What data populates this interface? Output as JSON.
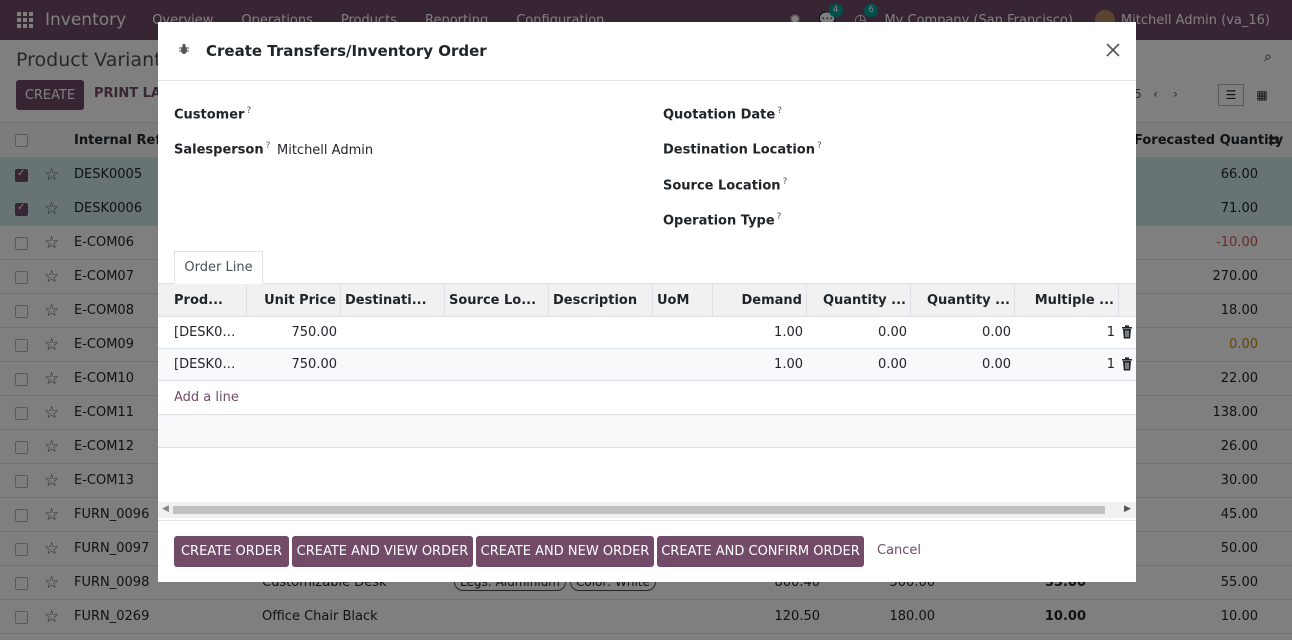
{
  "colors": {
    "brand": "#714b67",
    "selected_row": "#d0e6e6",
    "negative": "#d9534f",
    "warning": "#d08a0a"
  },
  "navbar": {
    "app_name": "Inventory",
    "menus": [
      "Overview",
      "Operations",
      "Products",
      "Reporting",
      "Configuration"
    ],
    "messages_count": "4",
    "activities_count": "6",
    "company": "My Company (San Francisco)",
    "user": "Mitchell Admin (va_16)"
  },
  "page": {
    "title": "Product Variants",
    "create_label": "CREATE",
    "print_label": "PRINT LAB",
    "pager": "5"
  },
  "list": {
    "headers": {
      "ref": "Internal Refer",
      "forecast": "Forecasted Quantity"
    },
    "rows": [
      {
        "ref": "DESK0005",
        "name": "",
        "attrs": [],
        "n1": "",
        "n2": "",
        "n3": "",
        "fq": "66.00",
        "selected": true,
        "tone": ""
      },
      {
        "ref": "DESK0006",
        "name": "",
        "attrs": [],
        "n1": "",
        "n2": "",
        "n3": "",
        "fq": "71.00",
        "selected": true,
        "tone": ""
      },
      {
        "ref": "E-COM06",
        "name": "",
        "attrs": [],
        "n1": "",
        "n2": "",
        "n3": "",
        "fq": "-10.00",
        "selected": false,
        "tone": "red"
      },
      {
        "ref": "E-COM07",
        "name": "",
        "attrs": [],
        "n1": "",
        "n2": "",
        "n3": "",
        "fq": "270.00",
        "selected": false,
        "tone": ""
      },
      {
        "ref": "E-COM08",
        "name": "",
        "attrs": [],
        "n1": "",
        "n2": "",
        "n3": "",
        "fq": "18.00",
        "selected": false,
        "tone": ""
      },
      {
        "ref": "E-COM09",
        "name": "",
        "attrs": [],
        "n1": "",
        "n2": "",
        "n3": "",
        "fq": "0.00",
        "selected": false,
        "tone": "orange"
      },
      {
        "ref": "E-COM10",
        "name": "",
        "attrs": [],
        "n1": "",
        "n2": "",
        "n3": "",
        "fq": "22.00",
        "selected": false,
        "tone": ""
      },
      {
        "ref": "E-COM11",
        "name": "",
        "attrs": [],
        "n1": "",
        "n2": "",
        "n3": "",
        "fq": "138.00",
        "selected": false,
        "tone": ""
      },
      {
        "ref": "E-COM12",
        "name": "",
        "attrs": [],
        "n1": "",
        "n2": "",
        "n3": "",
        "fq": "26.00",
        "selected": false,
        "tone": ""
      },
      {
        "ref": "E-COM13",
        "name": "",
        "attrs": [],
        "n1": "",
        "n2": "",
        "n3": "",
        "fq": "30.00",
        "selected": false,
        "tone": ""
      },
      {
        "ref": "FURN_0096",
        "name": "",
        "attrs": [],
        "n1": "",
        "n2": "",
        "n3": "",
        "fq": "45.00",
        "selected": false,
        "tone": ""
      },
      {
        "ref": "FURN_0097",
        "name": "",
        "attrs": [],
        "n1": "",
        "n2": "",
        "n3": "",
        "fq": "50.00",
        "selected": false,
        "tone": ""
      },
      {
        "ref": "FURN_0098",
        "name": "Customizable Desk",
        "attrs": [
          "Legs: Aluminium",
          "Color: White"
        ],
        "n1": "800.40",
        "n2": "500.00",
        "n3": "55.00",
        "fq": "55.00",
        "selected": false,
        "tone": ""
      },
      {
        "ref": "FURN_0269",
        "name": "Office Chair Black",
        "attrs": [],
        "n1": "120.50",
        "n2": "180.00",
        "n3": "10.00",
        "fq": "10.00",
        "selected": false,
        "tone": ""
      }
    ]
  },
  "modal": {
    "title": "Create Transfers/Inventory Order",
    "fields": {
      "customer": {
        "label": "Customer",
        "value": ""
      },
      "salesperson": {
        "label": "Salesperson",
        "value": "Mitchell Admin"
      },
      "quotation_date": {
        "label": "Quotation Date",
        "value": ""
      },
      "destination_location": {
        "label": "Destination Location",
        "value": ""
      },
      "source_location": {
        "label": "Source Location",
        "value": ""
      },
      "operation_type": {
        "label": "Operation Type",
        "value": ""
      }
    },
    "help_mark": "?",
    "tab_label": "Order Line",
    "columns": [
      "Prod...",
      "Unit Price",
      "Destinati...",
      "Source Lo...",
      "Description",
      "UoM",
      "Demand",
      "Quantity ...",
      "Quantity ...",
      "Multiple ..."
    ],
    "lines": [
      {
        "product": "[DESK00...",
        "unit_price": "750.00",
        "destination": "",
        "source": "",
        "description": "",
        "uom": "",
        "demand": "1.00",
        "qty1": "0.00",
        "qty2": "0.00",
        "multiple": "1"
      },
      {
        "product": "[DESK00...",
        "unit_price": "750.00",
        "destination": "",
        "source": "",
        "description": "",
        "uom": "",
        "demand": "1.00",
        "qty1": "0.00",
        "qty2": "0.00",
        "multiple": "1"
      }
    ],
    "add_line_label": "Add a line",
    "buttons": {
      "create_order": "CREATE ORDER",
      "create_view": "CREATE AND VIEW ORDER",
      "create_new": "CREATE AND NEW ORDER",
      "create_confirm": "CREATE AND CONFIRM ORDER",
      "cancel": "Cancel"
    }
  }
}
